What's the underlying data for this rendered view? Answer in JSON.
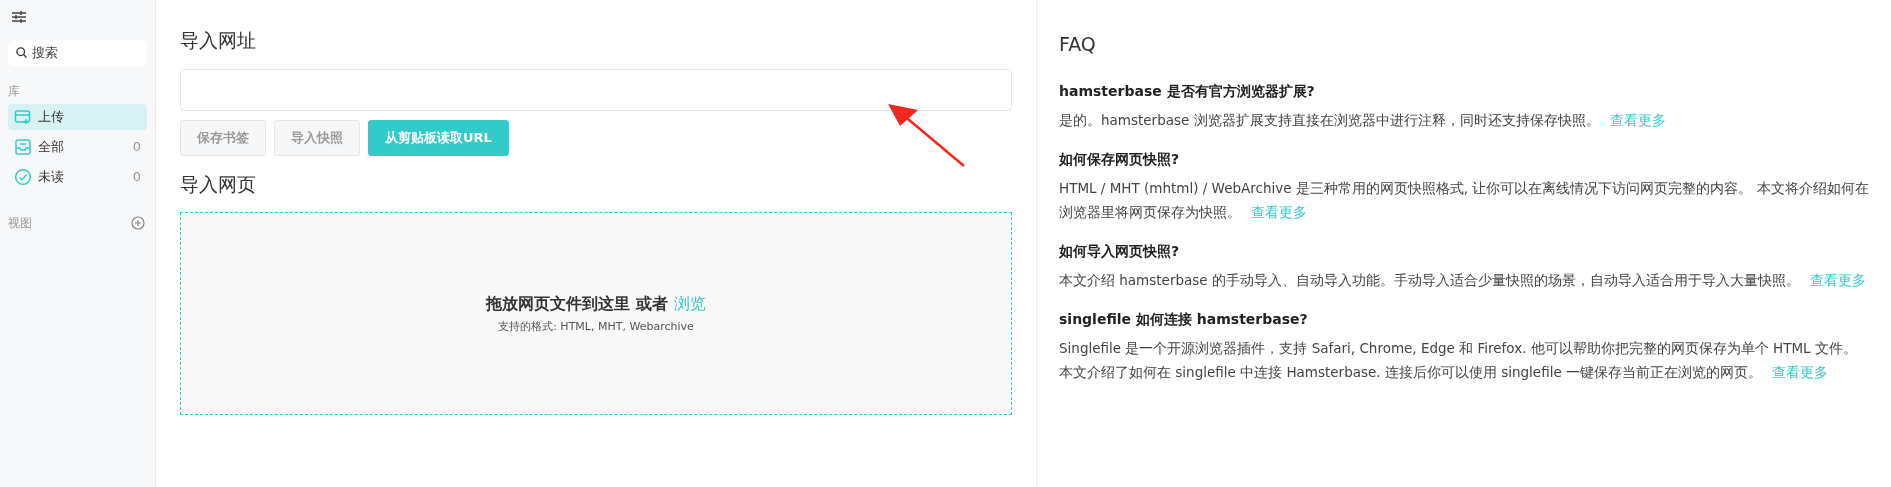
{
  "sidebar": {
    "search": {
      "placeholder": "搜索"
    },
    "library_label": "库",
    "items": [
      {
        "label": "上传",
        "kind": "upload",
        "selected": true
      },
      {
        "label": "全部",
        "kind": "inbox",
        "selected": false,
        "count": "0"
      },
      {
        "label": "未读",
        "kind": "check",
        "selected": false,
        "count": "0"
      }
    ],
    "views_label": "视图"
  },
  "import_url": {
    "title": "导入网址",
    "buttons": [
      {
        "label": "保存书签",
        "disabled": true
      },
      {
        "label": "导入快照",
        "disabled": true
      },
      {
        "label": "从剪贴板读取URL",
        "disabled": false
      }
    ]
  },
  "import_page": {
    "title": "导入网页",
    "drop_text": "拖放网页文件到这里 或者",
    "browse_link": "浏览",
    "formats": "支持的格式: HTML, MHT, Webarchive"
  },
  "faq": {
    "title": "FAQ",
    "items": [
      {
        "question": "hamsterbase 是否有官方浏览器扩展?",
        "answer": "是的。hamsterbase 浏览器扩展支持直接在浏览器中进行注释，同时还支持保存快照。",
        "link": "查看更多"
      },
      {
        "question": "如何保存网页快照?",
        "answer": "HTML / MHT (mhtml) / WebArchive 是三种常用的网页快照格式, 让你可以在离线情况下访问网页完整的内容。 本文将介绍如何在浏览器里将网页保存为快照。",
        "link": "查看更多"
      },
      {
        "question": "如何导入网页快照?",
        "answer": "本文介绍 hamsterbase 的手动导入、自动导入功能。手动导入适合少量快照的场景，自动导入适合用于导入大量快照。",
        "link": "查看更多"
      },
      {
        "question": "singlefile 如何连接 hamsterbase?",
        "answer": "Singlefile 是一个开源浏览器插件，支持 Safari, Chrome, Edge 和 Firefox. 他可以帮助你把完整的网页保存为单个 HTML 文件。本文介绍了如何在 singlefile 中连接 Hamsterbase. 连接后你可以使用 singlefile 一键保存当前正在浏览的网页。",
        "link": "查看更多"
      }
    ]
  }
}
